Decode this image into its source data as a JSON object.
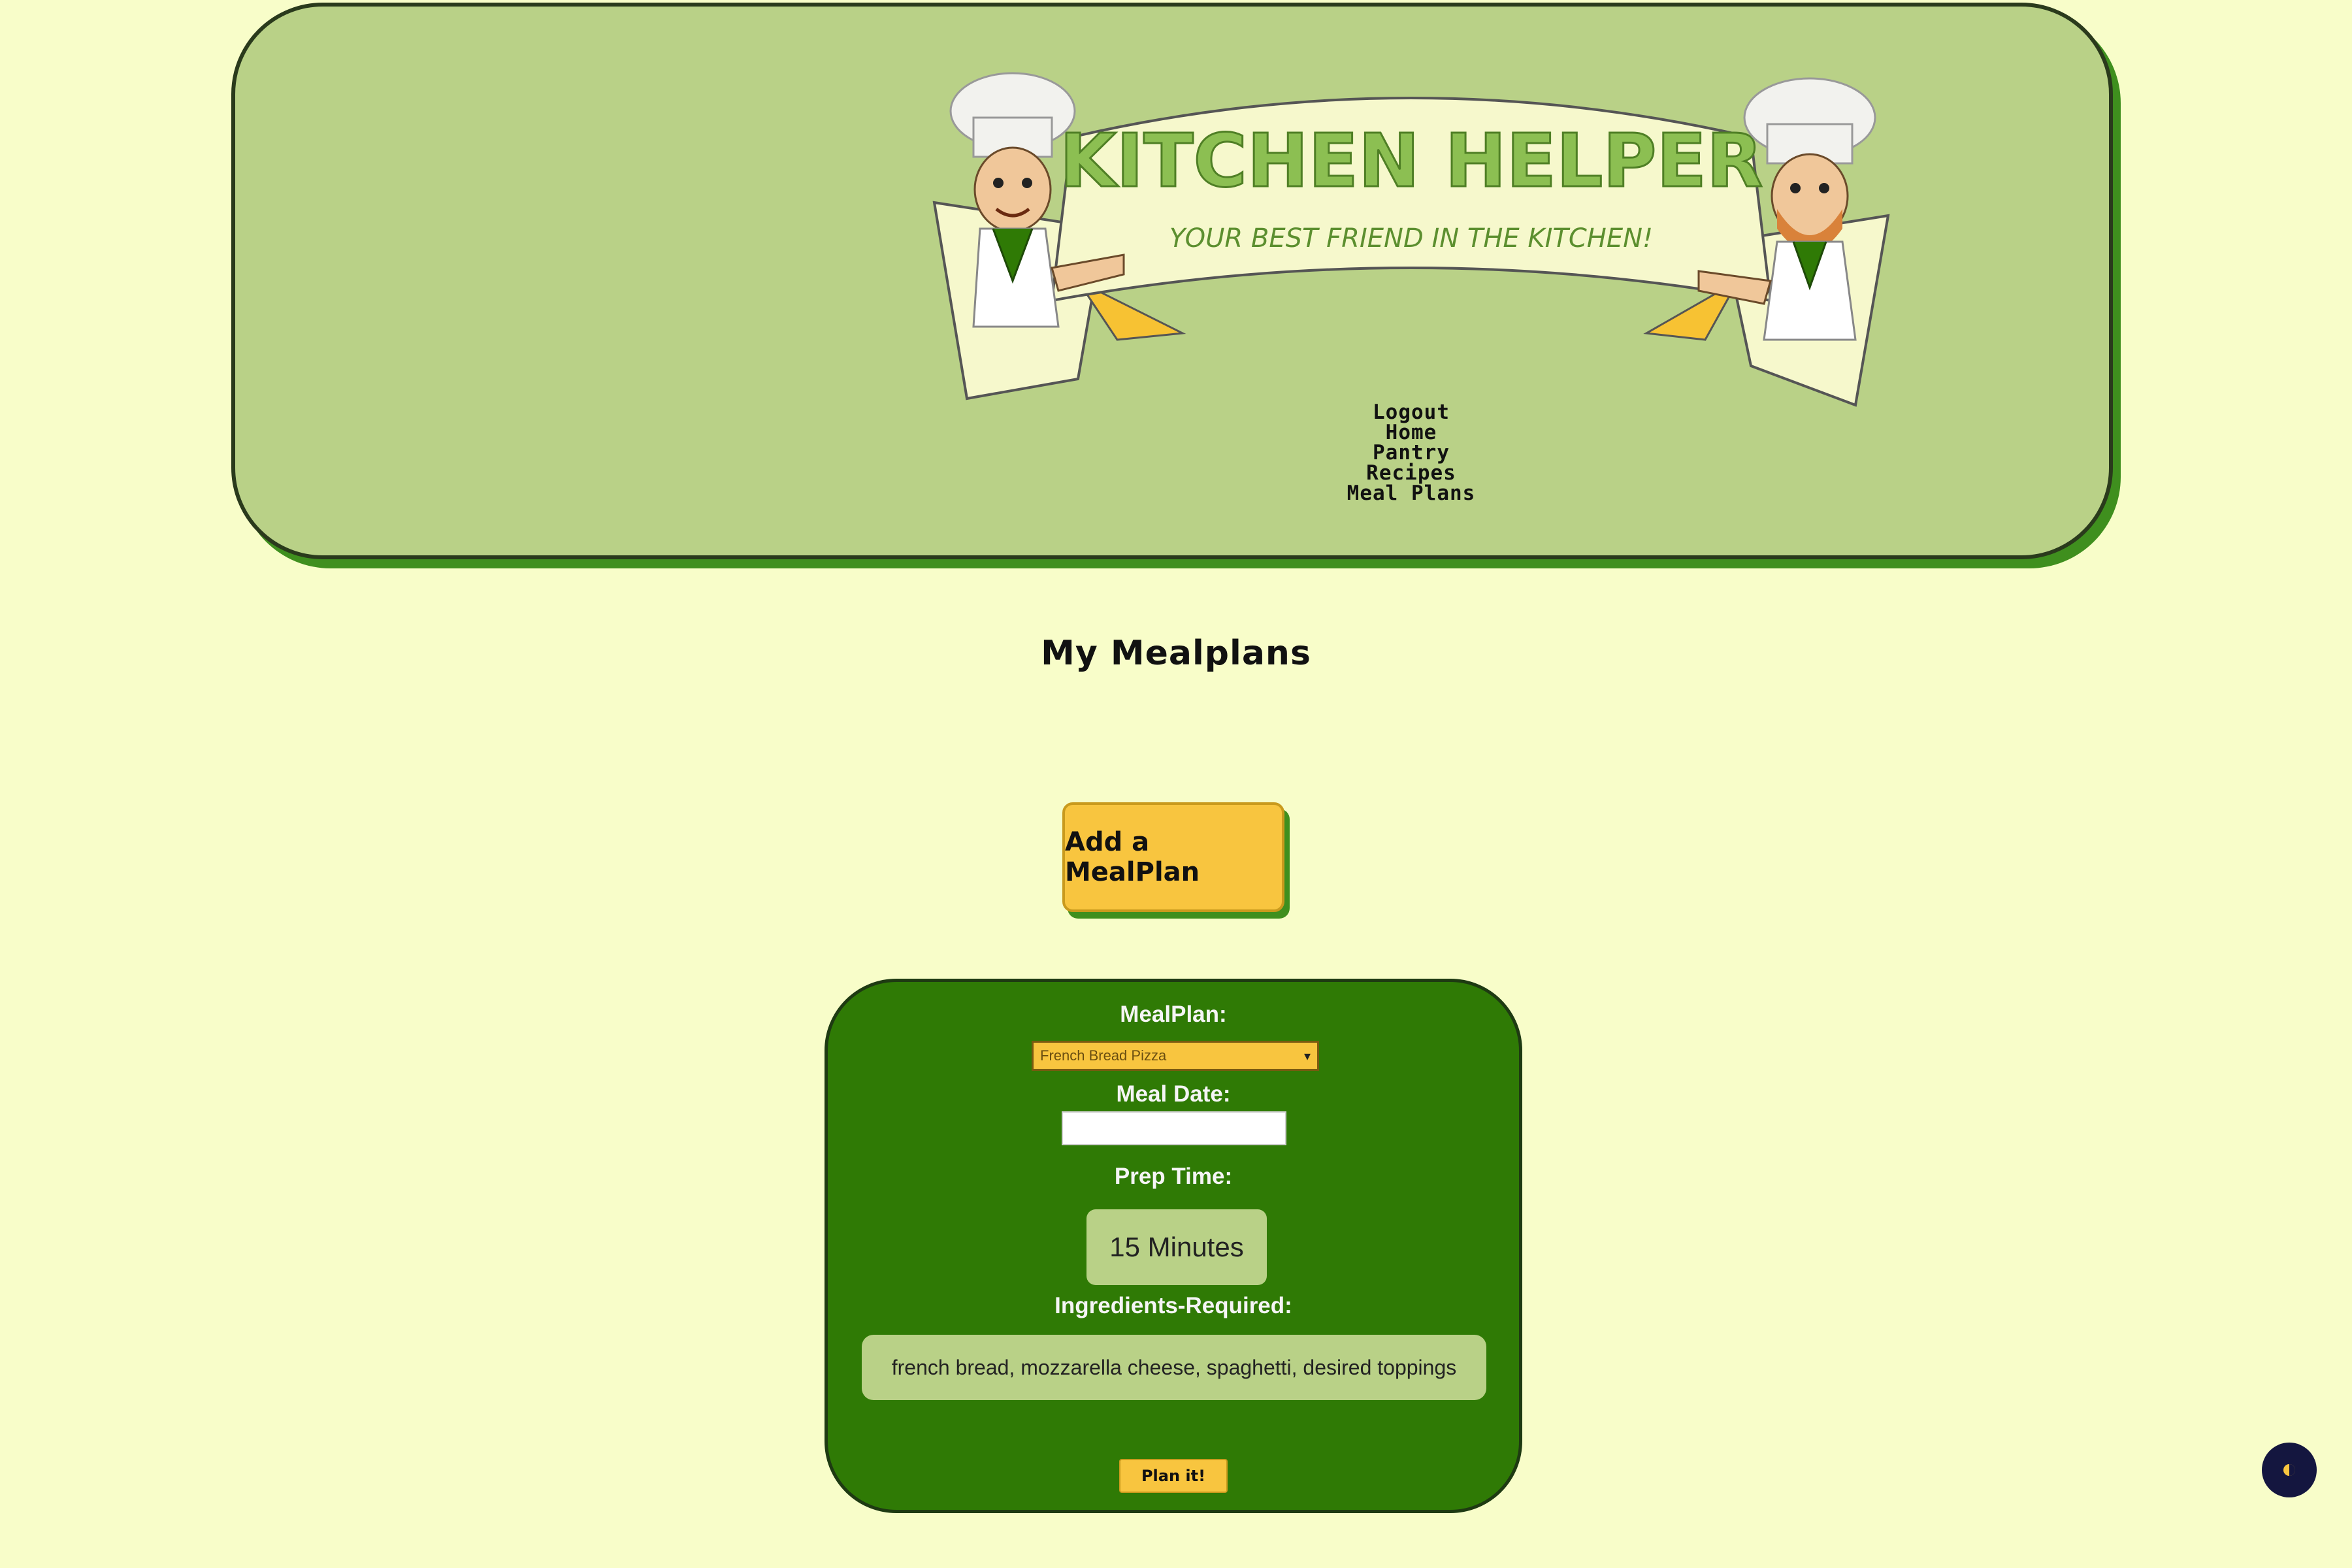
{
  "brand": {
    "title": "KITCHEN HELPER",
    "tagline": "YOUR BEST FRIEND IN THE KITCHEN!"
  },
  "nav": {
    "items": [
      {
        "label": "Logout"
      },
      {
        "label": "Home"
      },
      {
        "label": "Pantry"
      },
      {
        "label": "Recipes"
      },
      {
        "label": "Meal Plans"
      }
    ]
  },
  "main": {
    "title": "My Mealplans",
    "add_button": "Add a MealPlan"
  },
  "form": {
    "mealplan_label": "MealPlan:",
    "mealplan_selected": "French Bread Pizza",
    "meal_date_label": "Meal Date:",
    "meal_date_value": "",
    "prep_time_label": "Prep Time:",
    "prep_time_value": "15 Minutes",
    "ingredients_label": "Ingredients-Required:",
    "ingredients_value": "french bread, mozzarella cheese, spaghetti, desired toppings",
    "submit_label": "Plan it!"
  },
  "colors": {
    "background": "#f8fdc9",
    "header_green": "#b9d187",
    "form_green": "#2f7a05",
    "accent_yellow": "#f8c53f"
  },
  "icons": {
    "theme_toggle": "half-moon-icon",
    "select_caret": "caret-down-icon"
  }
}
